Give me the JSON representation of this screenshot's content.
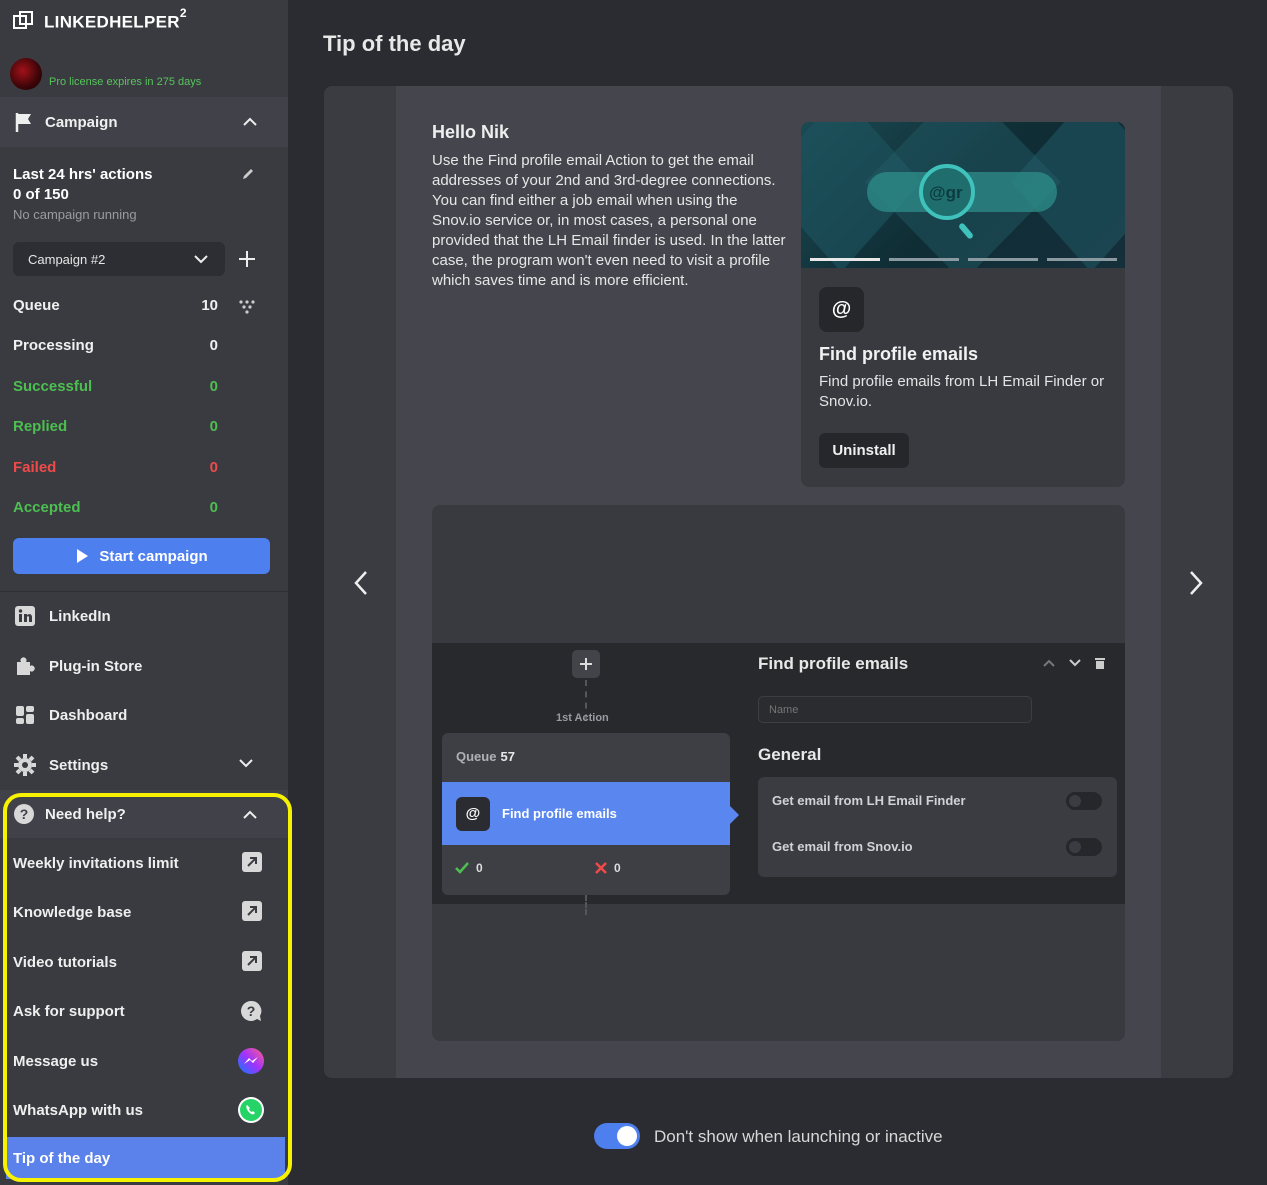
{
  "app": {
    "brand": "LINKEDHELPER",
    "brand_sup": "2",
    "license": "Pro license expires in 275 days"
  },
  "campaign": {
    "section_label": "Campaign",
    "stats_title": "Last 24 hrs' actions",
    "stats_count": "0 of 150",
    "stats_sub": "No campaign running",
    "selected": "Campaign #2",
    "rows": [
      {
        "label": "Queue",
        "value": "10",
        "color": "white"
      },
      {
        "label": "Processing",
        "value": "0",
        "color": "white"
      },
      {
        "label": "Successful",
        "value": "0",
        "color": "green"
      },
      {
        "label": "Replied",
        "value": "0",
        "color": "green"
      },
      {
        "label": "Failed",
        "value": "0",
        "color": "red"
      },
      {
        "label": "Accepted",
        "value": "0",
        "color": "green"
      }
    ],
    "start_label": "Start campaign"
  },
  "nav": {
    "linkedin": "LinkedIn",
    "plugin_store": "Plug-in Store",
    "dashboard": "Dashboard",
    "settings": "Settings"
  },
  "help": {
    "header": "Need help?",
    "items": [
      {
        "label": "Weekly invitations limit",
        "icon": "external-link-icon"
      },
      {
        "label": "Knowledge base",
        "icon": "external-link-icon"
      },
      {
        "label": "Video tutorials",
        "icon": "external-link-icon"
      },
      {
        "label": "Ask for support",
        "icon": "question-bubble-icon"
      },
      {
        "label": "Message us",
        "icon": "messenger-icon"
      },
      {
        "label": "WhatsApp with us",
        "icon": "whatsapp-icon"
      }
    ],
    "active": "Tip of the day"
  },
  "main": {
    "title": "Tip of the day",
    "greeting": "Hello Nik",
    "tip": "Use the Find profile email Action to get the email addresses of your 2nd and 3rd-degree connections. You can find either a job email when using the Snov.io service or, in most cases, a personal one provided that the LH Email finder is used. In the latter case, the program won't even need to visit a profile which saves time and is more efficient.",
    "card": {
      "icon_text": "@",
      "title": "Find profile emails",
      "desc": "Find profile emails from LH Email Finder or Snov.io.",
      "button": "Uninstall",
      "image_text": "@gr"
    },
    "demo": {
      "first_action": "1st Action",
      "queue_label": "Queue",
      "queue_value": "57",
      "node_label": "Find profile emails",
      "ok_count": "0",
      "fail_count": "0",
      "panel_title": "Find profile emails",
      "name_placeholder": "Name",
      "general": "General",
      "options": [
        "Get email from LH Email Finder",
        "Get email from Snov.io"
      ]
    },
    "footer_toggle_label": "Don't show when launching or inactive"
  },
  "colors": {
    "accent": "#4e7fef",
    "highlight": "#f6f200",
    "green": "#4cbf50",
    "red": "#ef4a4a"
  }
}
